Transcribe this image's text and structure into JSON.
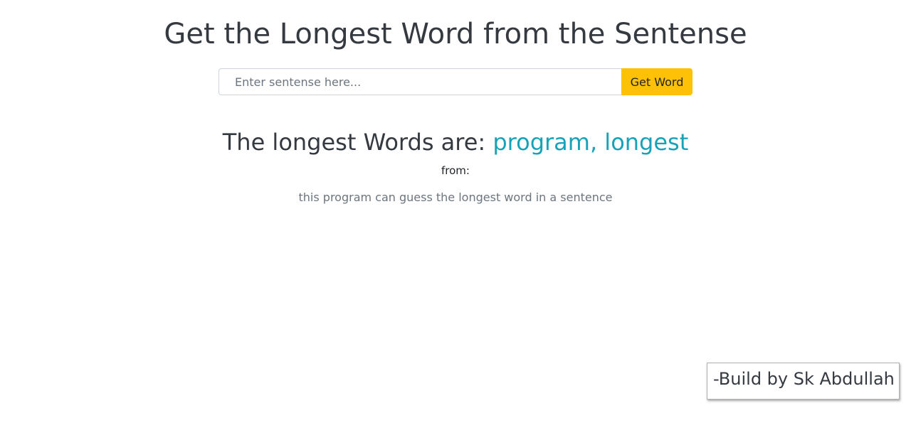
{
  "header": {
    "title": "Get the Longest Word from the Sentense"
  },
  "search": {
    "placeholder": "Enter sentense here...",
    "value": "",
    "button_label": "Get Word"
  },
  "result": {
    "prefix": "The longest Words are: ",
    "words": "program, longest",
    "from_label": "from:",
    "sentence": "this program can guess the longest word in a sentence"
  },
  "footer": {
    "credit": "-Build by Sk Abdullah"
  },
  "colors": {
    "accent_button": "#ffc107",
    "result_words": "#17a2b8",
    "text_dark": "#343a40",
    "text_muted": "#6c757d"
  }
}
